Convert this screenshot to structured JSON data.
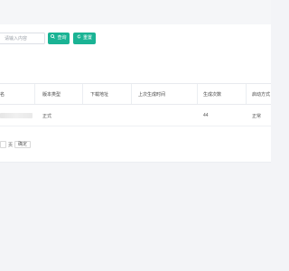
{
  "search": {
    "placeholder": "请输入内容",
    "search_label": "查询",
    "reset_label": "重置"
  },
  "table": {
    "columns": [
      "名",
      "版本类型",
      "下载地址",
      "上次生成时间",
      "生成次数",
      "启动方式"
    ],
    "rows": [
      {
        "name": "",
        "version_type": "正式",
        "download_url": "",
        "last_generated": "",
        "count": "44",
        "start_mode": "正常"
      }
    ]
  },
  "pagination": {
    "page_suffix": "页",
    "confirm_label": "确定",
    "page_value": ""
  },
  "colors": {
    "accent": "#1ab394",
    "background": "#f3f4f7",
    "card": "#ffffff"
  }
}
